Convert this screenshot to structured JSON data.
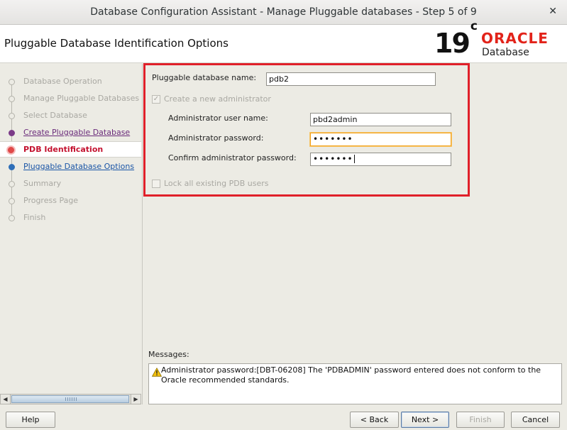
{
  "window": {
    "title": "Database Configuration Assistant - Manage Pluggable databases - Step 5 of 9",
    "close_glyph": "✕"
  },
  "header": {
    "page_title": "Pluggable Database Identification Options",
    "logo": {
      "version": "19",
      "version_suffix": "c",
      "brand": "ORACLE",
      "product": "Database"
    }
  },
  "nav": {
    "items": [
      {
        "label": "Database Operation",
        "state": "disabled"
      },
      {
        "label": "Manage Pluggable Databases",
        "state": "disabled"
      },
      {
        "label": "Select Database",
        "state": "disabled"
      },
      {
        "label": "Create Pluggable Database",
        "state": "done"
      },
      {
        "label": "PDB Identification",
        "state": "current"
      },
      {
        "label": "Pluggable Database Options",
        "state": "next"
      },
      {
        "label": "Summary",
        "state": "disabled"
      },
      {
        "label": "Progress Page",
        "state": "disabled"
      },
      {
        "label": "Finish",
        "state": "disabled"
      }
    ]
  },
  "form": {
    "pdb_name": {
      "label": "Pluggable database name:",
      "value": "pdb2"
    },
    "create_admin": {
      "label": "Create a new administrator",
      "checked": true
    },
    "admin_user": {
      "label": "Administrator user name:",
      "value": "pbd2admin"
    },
    "admin_password": {
      "label": "Administrator password:",
      "value": "•••••••"
    },
    "confirm_password": {
      "label": "Confirm administrator password:",
      "value": "•••••••"
    },
    "lock_users": {
      "label": "Lock all existing PDB users",
      "checked": false
    }
  },
  "messages": {
    "label": "Messages:",
    "text": "Administrator password:[DBT-06208] The 'PDBADMIN' password entered does not conform to the Oracle recommended standards."
  },
  "buttons": {
    "help": "Help",
    "back": "< Back",
    "next": "Next >",
    "finish": "Finish",
    "cancel": "Cancel"
  },
  "colors": {
    "highlight": "#e0202a",
    "oracle_red": "#e2231a",
    "current_step": "#c4122f",
    "focus_border": "#f2a11c"
  }
}
